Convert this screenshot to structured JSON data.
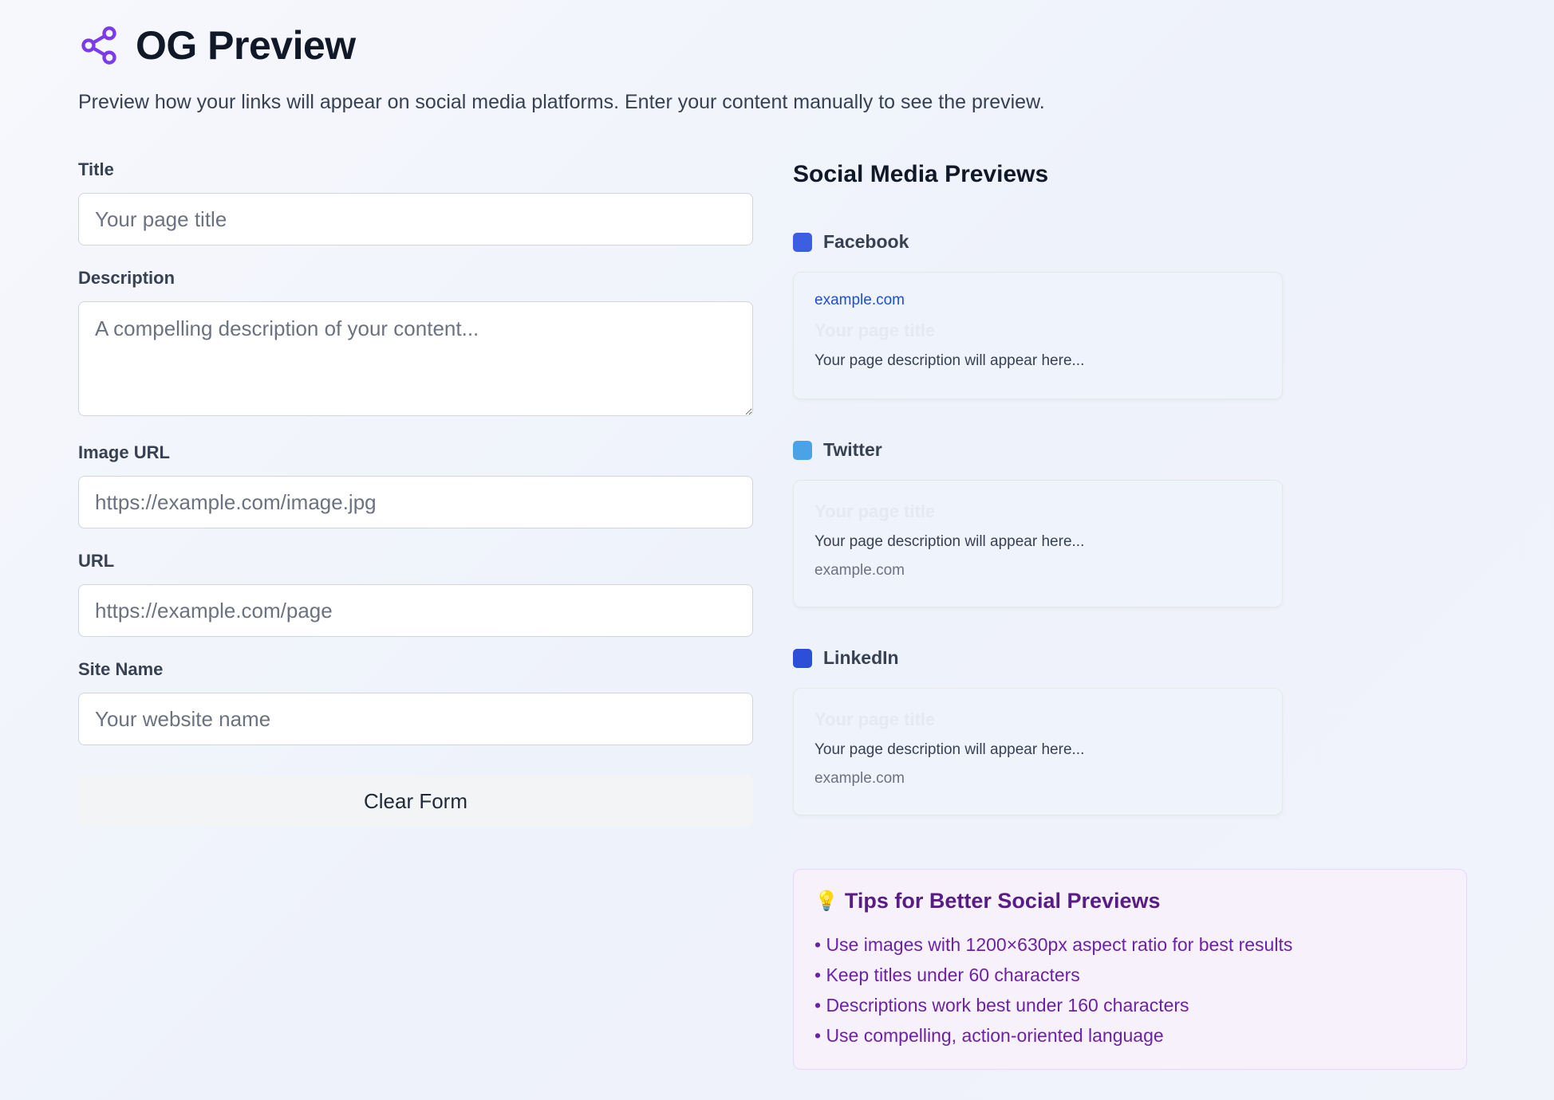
{
  "header": {
    "title": "OG Preview",
    "icon": "share-icon",
    "subtitle": "Preview how your links will appear on social media platforms. Enter your content manually to see the preview."
  },
  "form": {
    "title": {
      "label": "Title",
      "placeholder": "Your page title",
      "value": ""
    },
    "description": {
      "label": "Description",
      "placeholder": "A compelling description of your content...",
      "value": ""
    },
    "image_url": {
      "label": "Image URL",
      "placeholder": "https://example.com/image.jpg",
      "value": ""
    },
    "url": {
      "label": "URL",
      "placeholder": "https://example.com/page",
      "value": ""
    },
    "site_name": {
      "label": "Site Name",
      "placeholder": "Your website name",
      "value": ""
    },
    "clear_label": "Clear Form"
  },
  "previews": {
    "heading": "Social Media Previews",
    "facebook": {
      "name": "Facebook",
      "color": "#3b5fe0",
      "domain": "example.com",
      "title": "Your page title",
      "description": "Your page description will appear here..."
    },
    "twitter": {
      "name": "Twitter",
      "color": "#4aa3e6",
      "title": "Your page title",
      "description": "Your page description will appear here...",
      "domain": "example.com"
    },
    "linkedin": {
      "name": "LinkedIn",
      "color": "#2b4fd8",
      "title": "Your page title",
      "description": "Your page description will appear here...",
      "domain": "example.com"
    }
  },
  "tips": {
    "icon": "lightbulb-icon",
    "title": "Tips for Better Social Previews",
    "items": [
      "• Use images with 1200×630px aspect ratio for best results",
      "• Keep titles under 60 characters",
      "• Descriptions work best under 160 characters",
      "• Use compelling, action-oriented language"
    ]
  },
  "colors": {
    "accent": "#7c3aed",
    "tips_text": "#6b21a8",
    "link": "#1d4ed8"
  }
}
